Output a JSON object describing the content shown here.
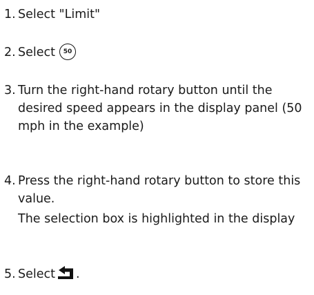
{
  "steps": [
    {
      "number": "1.",
      "text": "Select \"Limit\""
    },
    {
      "number": "2.",
      "text": "Select",
      "icon": "speed-limit-50-icon",
      "icon_text": "50"
    },
    {
      "number": "3.",
      "text": "Turn the right-hand rotary button until the desired speed appears in the display panel (50 mph in the example)"
    },
    {
      "number": "4.",
      "text": "Press the right-hand rotary button to store this value.",
      "note": "The selection box is highlighted in the display"
    },
    {
      "number": "5.",
      "text": "Select",
      "icon": "back-arrow-icon",
      "suffix": "."
    }
  ]
}
